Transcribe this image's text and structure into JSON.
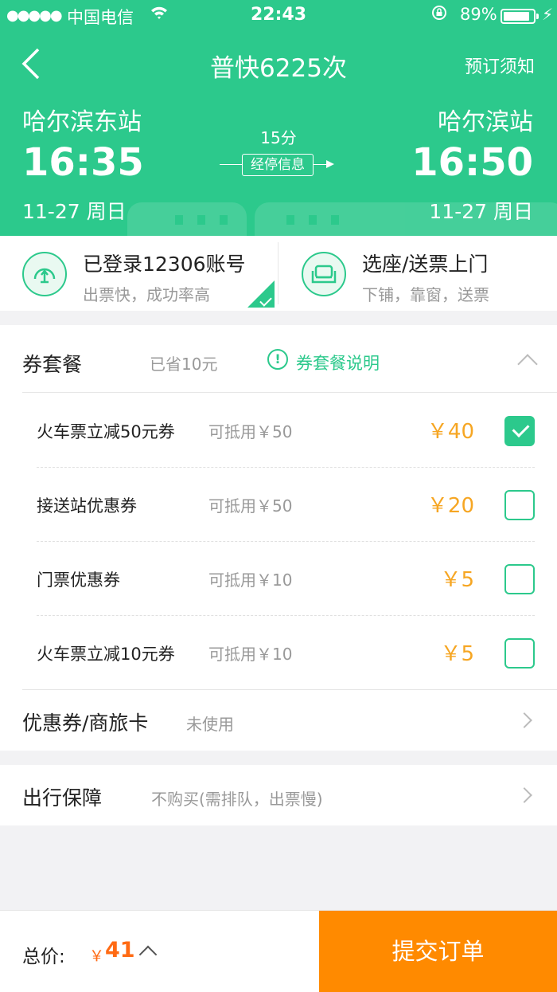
{
  "status_bar": {
    "signal": "●●●●●",
    "carrier": "中国电信",
    "time": "22:43",
    "battery_percent": "89%",
    "battery_level": 0.89
  },
  "nav": {
    "title": "普快6225次",
    "right_link": "预订须知"
  },
  "journey": {
    "departure_station": "哈尔滨东站",
    "arrival_station": "哈尔滨站",
    "departure_time": "16:35",
    "arrival_time": "16:50",
    "departure_date": "11-27 周日",
    "arrival_date": "11-27 周日",
    "duration": "15分",
    "stop_info_label": "经停信息"
  },
  "features": [
    {
      "title": "已登录12306账号",
      "subtitle": "出票快，成功率高",
      "selected": true,
      "icon": "train-station-icon"
    },
    {
      "title": "选座/送票上门",
      "subtitle": "下铺，靠窗，送票",
      "selected": false,
      "icon": "seat-icon"
    }
  ],
  "package": {
    "title": "券套餐",
    "saved": "已省10元",
    "info_link": "券套餐说明",
    "info_icon": "!",
    "coupons": [
      {
        "name": "火车票立减50元券",
        "limit": "可抵用￥50",
        "price": "￥40",
        "checked": true
      },
      {
        "name": "接送站优惠券",
        "limit": "可抵用￥50",
        "price": "￥20",
        "checked": false
      },
      {
        "name": "门票优惠券",
        "limit": "可抵用￥10",
        "price": "￥5",
        "checked": false
      },
      {
        "name": "火车票立减10元券",
        "limit": "可抵用￥10",
        "price": "￥5",
        "checked": false
      }
    ]
  },
  "discount_card": {
    "title": "优惠券/商旅卡",
    "value": "未使用"
  },
  "insurance": {
    "title": "出行保障",
    "value": "不购买(需排队，出票慢)"
  },
  "bottom": {
    "total_label": "总价:",
    "currency": "￥",
    "total_value": "41",
    "submit_label": "提交订单"
  },
  "colors": {
    "brand_green": "#2cc98c",
    "price_orange": "#f6a623",
    "submit_orange": "#ff8a00"
  }
}
